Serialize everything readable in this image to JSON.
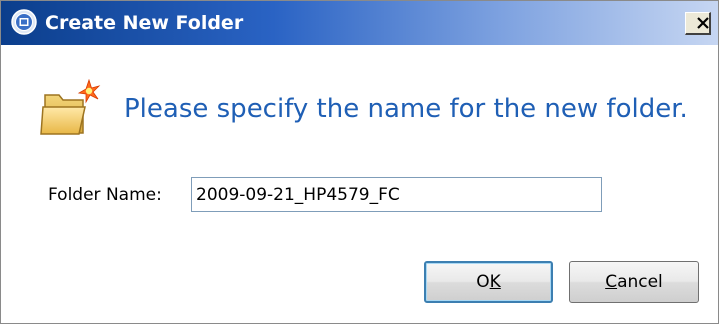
{
  "window": {
    "title": "Create New Folder",
    "close_label": "Close",
    "close_glyph": "X",
    "app_icon": "app-logo-icon",
    "colors": {
      "titlebar_start": "#0b3e8c",
      "titlebar_end": "#c6d6f2",
      "message": "#1f5fb5"
    }
  },
  "content": {
    "icon": "new-folder-icon",
    "message": "Please specify the name for the new folder."
  },
  "form": {
    "folder_name_label": "Folder Name:",
    "folder_name_value": "2009-09-21_HP4579_FC"
  },
  "buttons": {
    "ok": {
      "pre": "O",
      "mnemonic": "K",
      "post": ""
    },
    "cancel": {
      "pre": "",
      "mnemonic": "C",
      "post": "ancel"
    }
  }
}
